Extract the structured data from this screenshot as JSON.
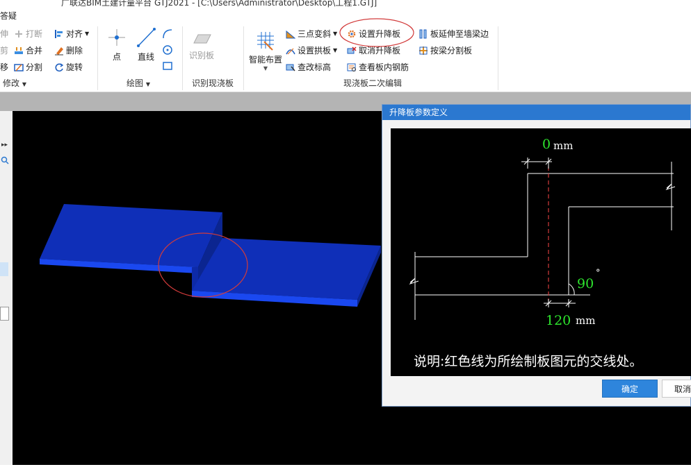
{
  "window": {
    "title": "广联达BIM土建计量平台 GTJ2021 - [C:\\Users\\Administrator\\Desktop\\工程1.GTJ]",
    "help_search": "答疑"
  },
  "ribbon": {
    "modify": {
      "items": [
        "伸",
        "打断",
        "对齐",
        "剪",
        "合并",
        "删除",
        "移",
        "分割",
        "旋转"
      ],
      "group_label": "修改"
    },
    "draw": {
      "point": "点",
      "line": "直线",
      "group_label": "绘图"
    },
    "recognize": {
      "button": "识别板",
      "group_label": "识别现浇板"
    },
    "slab_edit": {
      "smart_layout": "智能布置",
      "three_point_slope": "三点变斜",
      "set_arch_slab": "设置拱板",
      "check_elevation": "查改标高",
      "set_drop_slab": "设置升降板",
      "cancel_drop_slab": "取消升降板",
      "view_rebar": "查看板内钢筋",
      "extend_to_wall": "板延伸至墙梁边",
      "split_by_beam": "按梁分割板",
      "group_label": "现浇板二次编辑"
    }
  },
  "dialog": {
    "title": "升降板参数定义",
    "top_offset": "0",
    "top_unit": "mm",
    "angle": "90",
    "angle_unit": "°",
    "bottom_offset": "120",
    "bottom_unit": "mm",
    "note": "说明:红色线为所绘制板图元的交线处。",
    "ok": "确定",
    "cancel": "取消"
  },
  "colors": {
    "slab": "#0f2fb8",
    "highlight_circle": "#d23b3b",
    "dim_value": "#2ee62e",
    "accent": "#2b78d0"
  }
}
